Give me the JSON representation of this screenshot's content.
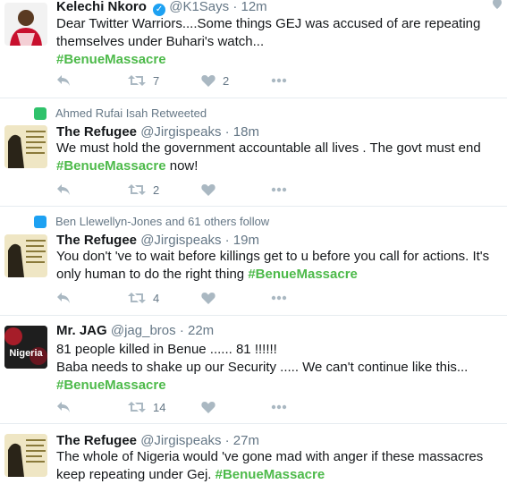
{
  "tweets": [
    {
      "name": "Kelechi Nkoro",
      "handle": "@K1Says",
      "time": "12m",
      "text": "Dear Twitter Warriors....Some things GEJ was accused of are repeating themselves under Buhari's watch...",
      "hashtag": "#BenueMassacre",
      "retweet_count": "7",
      "like_count": "2"
    },
    {
      "context": "Ahmed Rufai Isah Retweeted",
      "name": "The Refugee",
      "handle": "@Jirgispeaks",
      "time": "18m",
      "text": "We must hold the government accountable all lives . The govt must end",
      "hashtag": "#BenueMassacre",
      "text_after": "now!",
      "retweet_count": "2",
      "like_count": ""
    },
    {
      "context": "Ben Llewellyn-Jones and 61 others follow",
      "name": "The Refugee",
      "handle": "@Jirgispeaks",
      "time": "19m",
      "text": "You don't 've to wait before killings get to u before you call for actions. It's only human to do the right thing",
      "hashtag": "#BenueMassacre",
      "retweet_count": "4",
      "like_count": ""
    },
    {
      "name": "Mr. JAG",
      "handle": "@jag_bros",
      "time": "22m",
      "line1": "81 people killed in Benue ...... 81 !!!!!!",
      "line2": "Baba needs to shake up our Security  ..... We can't continue like this...",
      "hashtag": "#BenueMassacre",
      "retweet_count": "14",
      "like_count": "",
      "avatar_text": "Nigeria"
    },
    {
      "name": "The Refugee",
      "handle": "@Jirgispeaks",
      "time": "27m",
      "text": "The whole of Nigeria would 've gone mad with anger if these massacres keep repeating under Gej.",
      "hashtag": "#BenueMassacre"
    }
  ],
  "colors": {
    "hashtag": "#4dba4a",
    "retweet_context": "#2fc26b",
    "follow_context": "#1da1f2",
    "link": "#1da1f2"
  },
  "icons": {
    "reply": "reply-icon",
    "retweet": "retweet-icon",
    "like": "heart-icon",
    "more": "more-icon",
    "verified": "verified-icon"
  }
}
